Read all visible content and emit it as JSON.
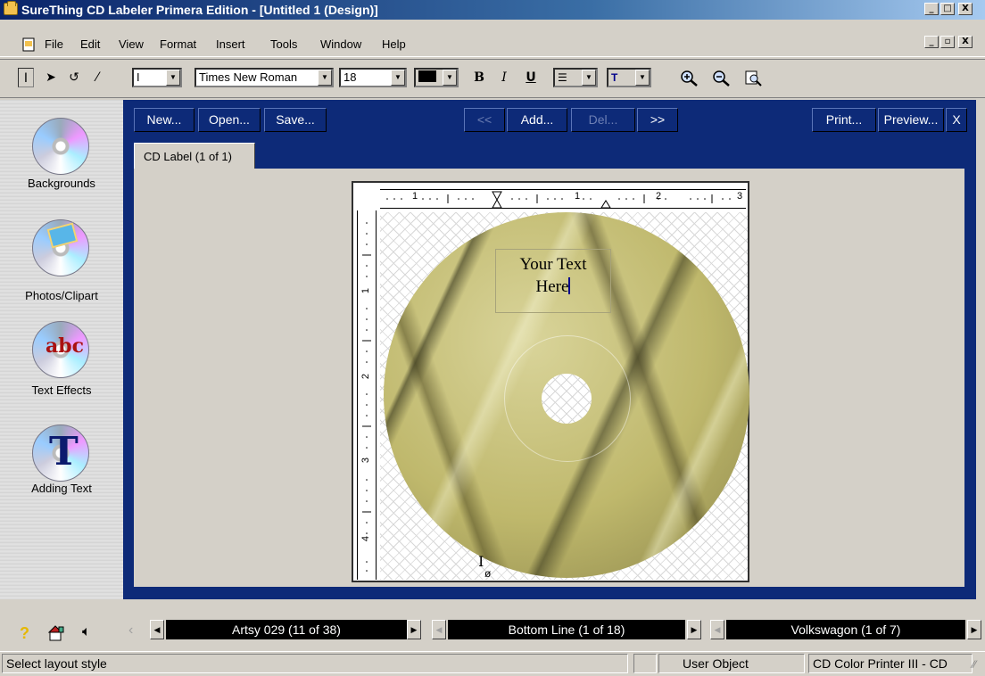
{
  "window": {
    "title": "SureThing CD Labeler Primera Edition - [Untitled 1 (Design)]",
    "caption_buttons": [
      "_",
      "□",
      "X"
    ],
    "mdi_buttons": [
      "_",
      "▫",
      "X"
    ]
  },
  "menu": {
    "items": [
      "File",
      "Edit",
      "View",
      "Format",
      "Insert",
      "Tools",
      "Window",
      "Help"
    ]
  },
  "toolbar": {
    "tools": [
      "text-cursor-icon",
      "arrow-pointer-icon",
      "rotate-icon",
      "eyedropper-icon"
    ],
    "text_mode_value": "I",
    "font_value": "Times New Roman",
    "size_value": "18",
    "bold": "B",
    "italic": "I",
    "underline": "U",
    "zoom_icons": [
      "zoom-in-icon",
      "zoom-out-icon",
      "zoom-fit-icon"
    ]
  },
  "sidebar": {
    "items": [
      {
        "label": "Backgrounds",
        "icon": "backgrounds-disc-icon"
      },
      {
        "label": "Photos/Clipart",
        "icon": "photos-clipart-icon"
      },
      {
        "label": "Text Effects",
        "icon": "text-effects-icon"
      },
      {
        "label": "Adding Text",
        "icon": "adding-text-icon"
      }
    ]
  },
  "navbar": {
    "new": "New...",
    "open": "Open...",
    "save": "Save...",
    "prev": "<<",
    "add": "Add...",
    "del": "Del...",
    "next": ">>",
    "print": "Print...",
    "preview": "Preview...",
    "close": "X"
  },
  "tab": {
    "label": "CD Label (1 of 1)"
  },
  "canvas": {
    "ruler_h_marks": [
      "1",
      "1",
      "2",
      "3"
    ],
    "ruler_v_marks": [
      "1",
      "2",
      "3",
      "4"
    ],
    "text_line1": "Your Text",
    "text_line2": "Here"
  },
  "stylebar": {
    "layout": "Artsy 029 (11 of 38)",
    "line": "Bottom Line (1 of 18)",
    "font": "Volkswagon (1 of 7)"
  },
  "status": {
    "message": "Select layout style",
    "object": "User Object",
    "printer": "CD Color Printer III - CD"
  },
  "colors": {
    "title_bar": "#0a246a",
    "frame_blue": "#0d2a78",
    "face": "#d4d0c8"
  }
}
